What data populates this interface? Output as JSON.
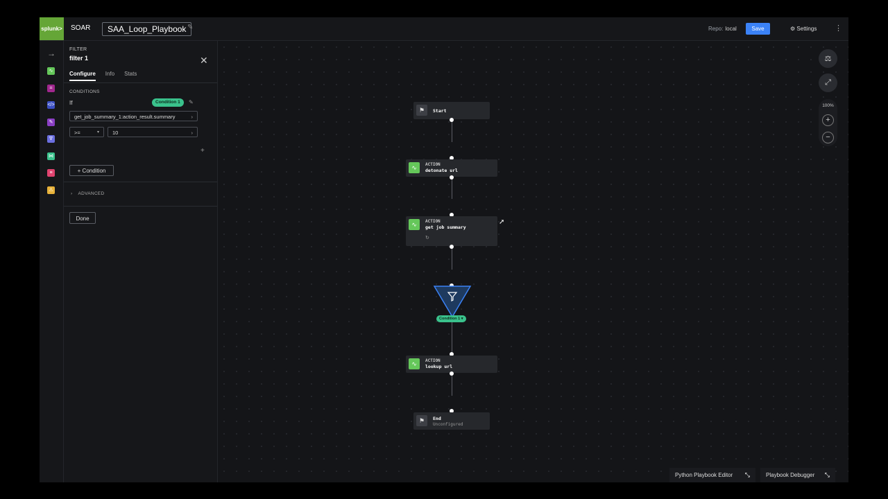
{
  "header": {
    "logo_text": "splunk>",
    "app_name": "SOAR",
    "playbook_name": "SAA_Loop_Playbook",
    "repo_label": "Repo:",
    "repo_value": "local",
    "save_label": "Save",
    "settings_label": "Settings"
  },
  "rail": {
    "icons": [
      {
        "name": "action-icon",
        "color": "#65c75a"
      },
      {
        "name": "utility-icon",
        "color": "#a1278e"
      },
      {
        "name": "code-icon",
        "color": "#3b4fc4"
      },
      {
        "name": "prompt-icon",
        "color": "#8a3fc4"
      },
      {
        "name": "filter-icon",
        "color": "#6b6fe0"
      },
      {
        "name": "decision-icon",
        "color": "#3ac28c"
      },
      {
        "name": "format-icon",
        "color": "#e0436f"
      },
      {
        "name": "playbook-icon",
        "color": "#e8b23a"
      }
    ]
  },
  "panel": {
    "eyebrow": "FILTER",
    "title": "filter 1",
    "tabs": [
      "Configure",
      "Info",
      "Stats"
    ],
    "conditions_header": "CONDITIONS",
    "if_label": "If",
    "condition_badge": "Condition 1",
    "field_path": "get_job_summary_1:action_result.summary",
    "operator": ">=",
    "value": "10",
    "add_condition": "Condition",
    "advanced": "ADVANCED",
    "done": "Done"
  },
  "canvas": {
    "start_label": "Start",
    "nodes": [
      {
        "eyebrow": "ACTION",
        "label": "detonate url"
      },
      {
        "eyebrow": "ACTION",
        "label": "get job summary"
      },
      {
        "eyebrow": "ACTION",
        "label": "lookup url"
      }
    ],
    "filter_chip": "Condition 1",
    "end_label": "End",
    "end_sub": "Unconfigured"
  },
  "zoom": {
    "level": "100%"
  },
  "bottom": {
    "python_editor": "Python Playbook Editor",
    "debugger": "Playbook Debugger"
  }
}
